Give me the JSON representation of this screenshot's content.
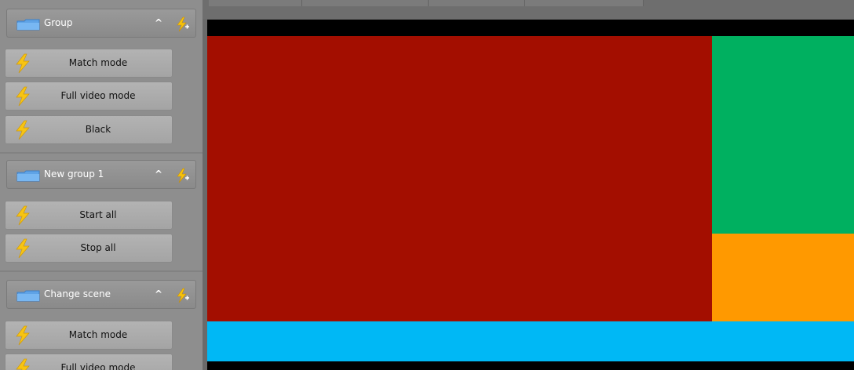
{
  "sidebar": {
    "groups": [
      {
        "title": "Group",
        "collapse_glyph": "^",
        "actions": [
          "Match mode",
          "Full video mode",
          "Black"
        ]
      },
      {
        "title": "New group 1",
        "collapse_glyph": "^",
        "actions": [
          "Start all",
          "Stop all"
        ]
      },
      {
        "title": "Change scene",
        "collapse_glyph": "^",
        "actions": [
          "Match mode",
          "Full video mode"
        ]
      }
    ]
  },
  "preview": {
    "layers": [
      {
        "name": "red-layer",
        "color": "#a30e00"
      },
      {
        "name": "green-layer",
        "color": "#00b060"
      },
      {
        "name": "orange-layer",
        "color": "#ff9900"
      },
      {
        "name": "blue-layer",
        "color": "#00b8f5"
      }
    ]
  },
  "icons": {
    "group_icon": "folder-icon",
    "group_action_icon": "add-lightning-icon",
    "action_icon": "lightning-icon"
  }
}
